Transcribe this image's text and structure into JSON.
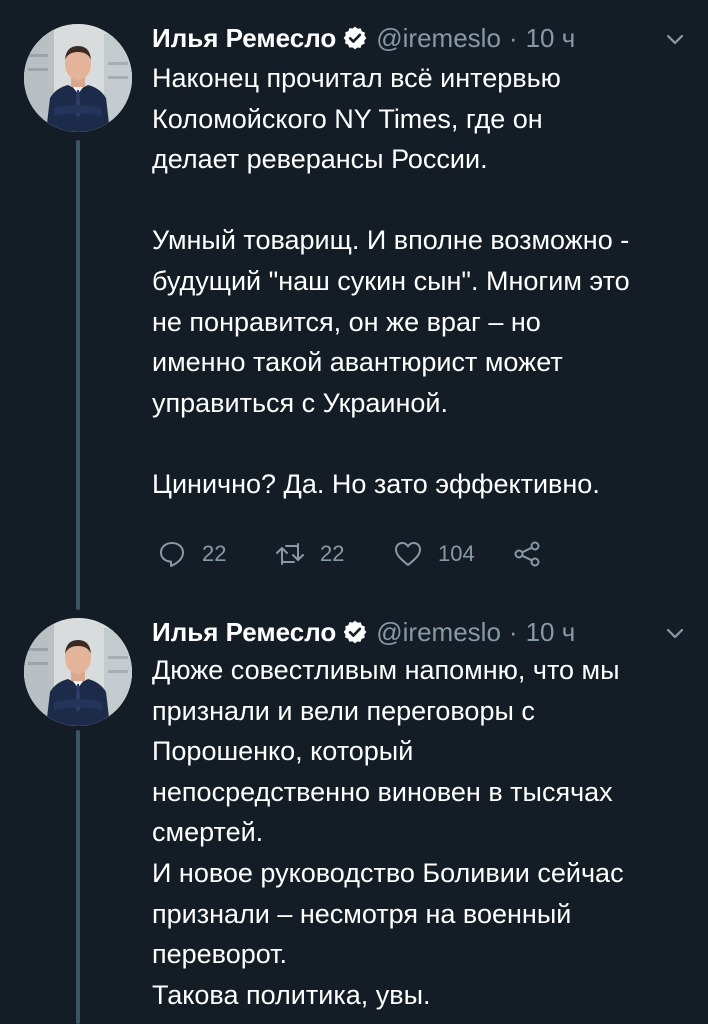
{
  "tweets": [
    {
      "author": {
        "name": "Илья Ремесло",
        "handle": "@iremeslo",
        "time": "10 ч",
        "verified_icon": "verified-badge-icon",
        "avatar_icon": "avatar-photo"
      },
      "text": "Наконец прочитал всё интервью\nКоломойского NY Times, где он\nделает реверансы России.\n\nУмный товарищ. И вполне возможно -\nбудущий \"наш сукин сын\". Многим это\nне понравится, он же враг – но\nименно такой авантюрист может\nуправиться с Украиной.\n\nЦинично? Да. Но зато эффективно.",
      "actions": {
        "reply_count": "22",
        "retweet_count": "22",
        "like_count": "104"
      }
    },
    {
      "author": {
        "name": "Илья Ремесло",
        "handle": "@iremeslo",
        "time": "10 ч",
        "verified_icon": "verified-badge-icon",
        "avatar_icon": "avatar-photo"
      },
      "text": "Дюже совестливым напомню, что мы\nпризнали и вели переговоры с\nПорошенко, который\nнепосредственно виновен в тысячах\nсмертей.\nИ новое руководство Боливии сейчас\nпризнали – несмотря на военный\nпереворот.\nТакова политика, увы."
    }
  ],
  "colors": {
    "background": "#141d26",
    "text": "#ffffff",
    "secondary": "#8899a6",
    "thread_line": "#3d5466"
  }
}
